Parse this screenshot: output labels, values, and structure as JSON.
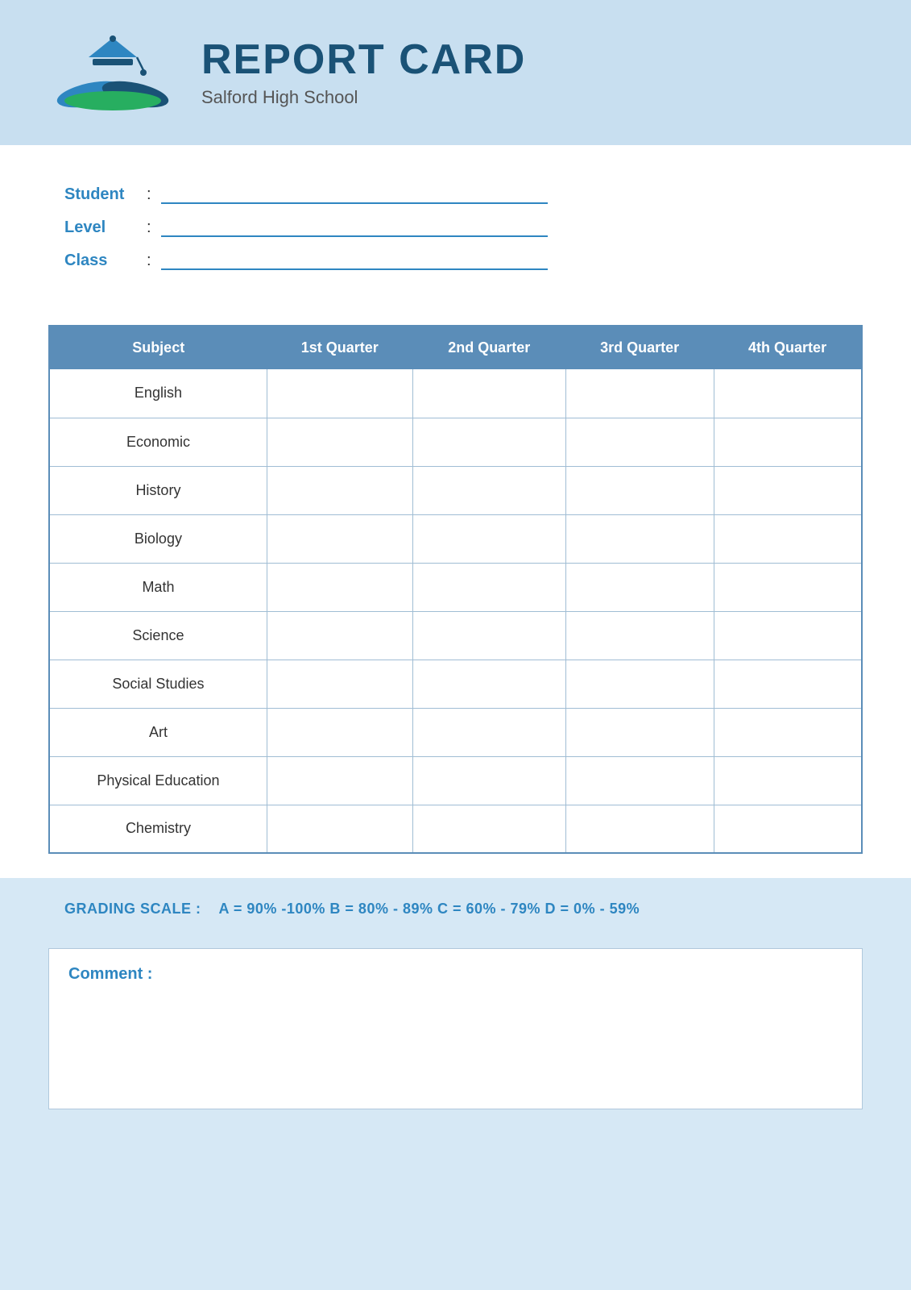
{
  "header": {
    "title": "REPORT CARD",
    "school": "Salford High School"
  },
  "info": {
    "student_label": "Student",
    "level_label": "Level",
    "class_label": "Class",
    "colon": ":"
  },
  "table": {
    "headers": [
      "Subject",
      "1st Quarter",
      "2nd Quarter",
      "3rd Quarter",
      "4th Quarter"
    ],
    "rows": [
      {
        "subject": "English"
      },
      {
        "subject": "Economic"
      },
      {
        "subject": "History"
      },
      {
        "subject": "Biology"
      },
      {
        "subject": "Math"
      },
      {
        "subject": "Science"
      },
      {
        "subject": "Social Studies"
      },
      {
        "subject": "Art"
      },
      {
        "subject": "Physical Education"
      },
      {
        "subject": "Chemistry"
      }
    ]
  },
  "grading": {
    "label": "GRADING SCALE :",
    "scale": "A = 90% -100%  B = 80% - 89%  C = 60% - 79%  D = 0% - 59%"
  },
  "comment": {
    "label": "Comment :"
  }
}
